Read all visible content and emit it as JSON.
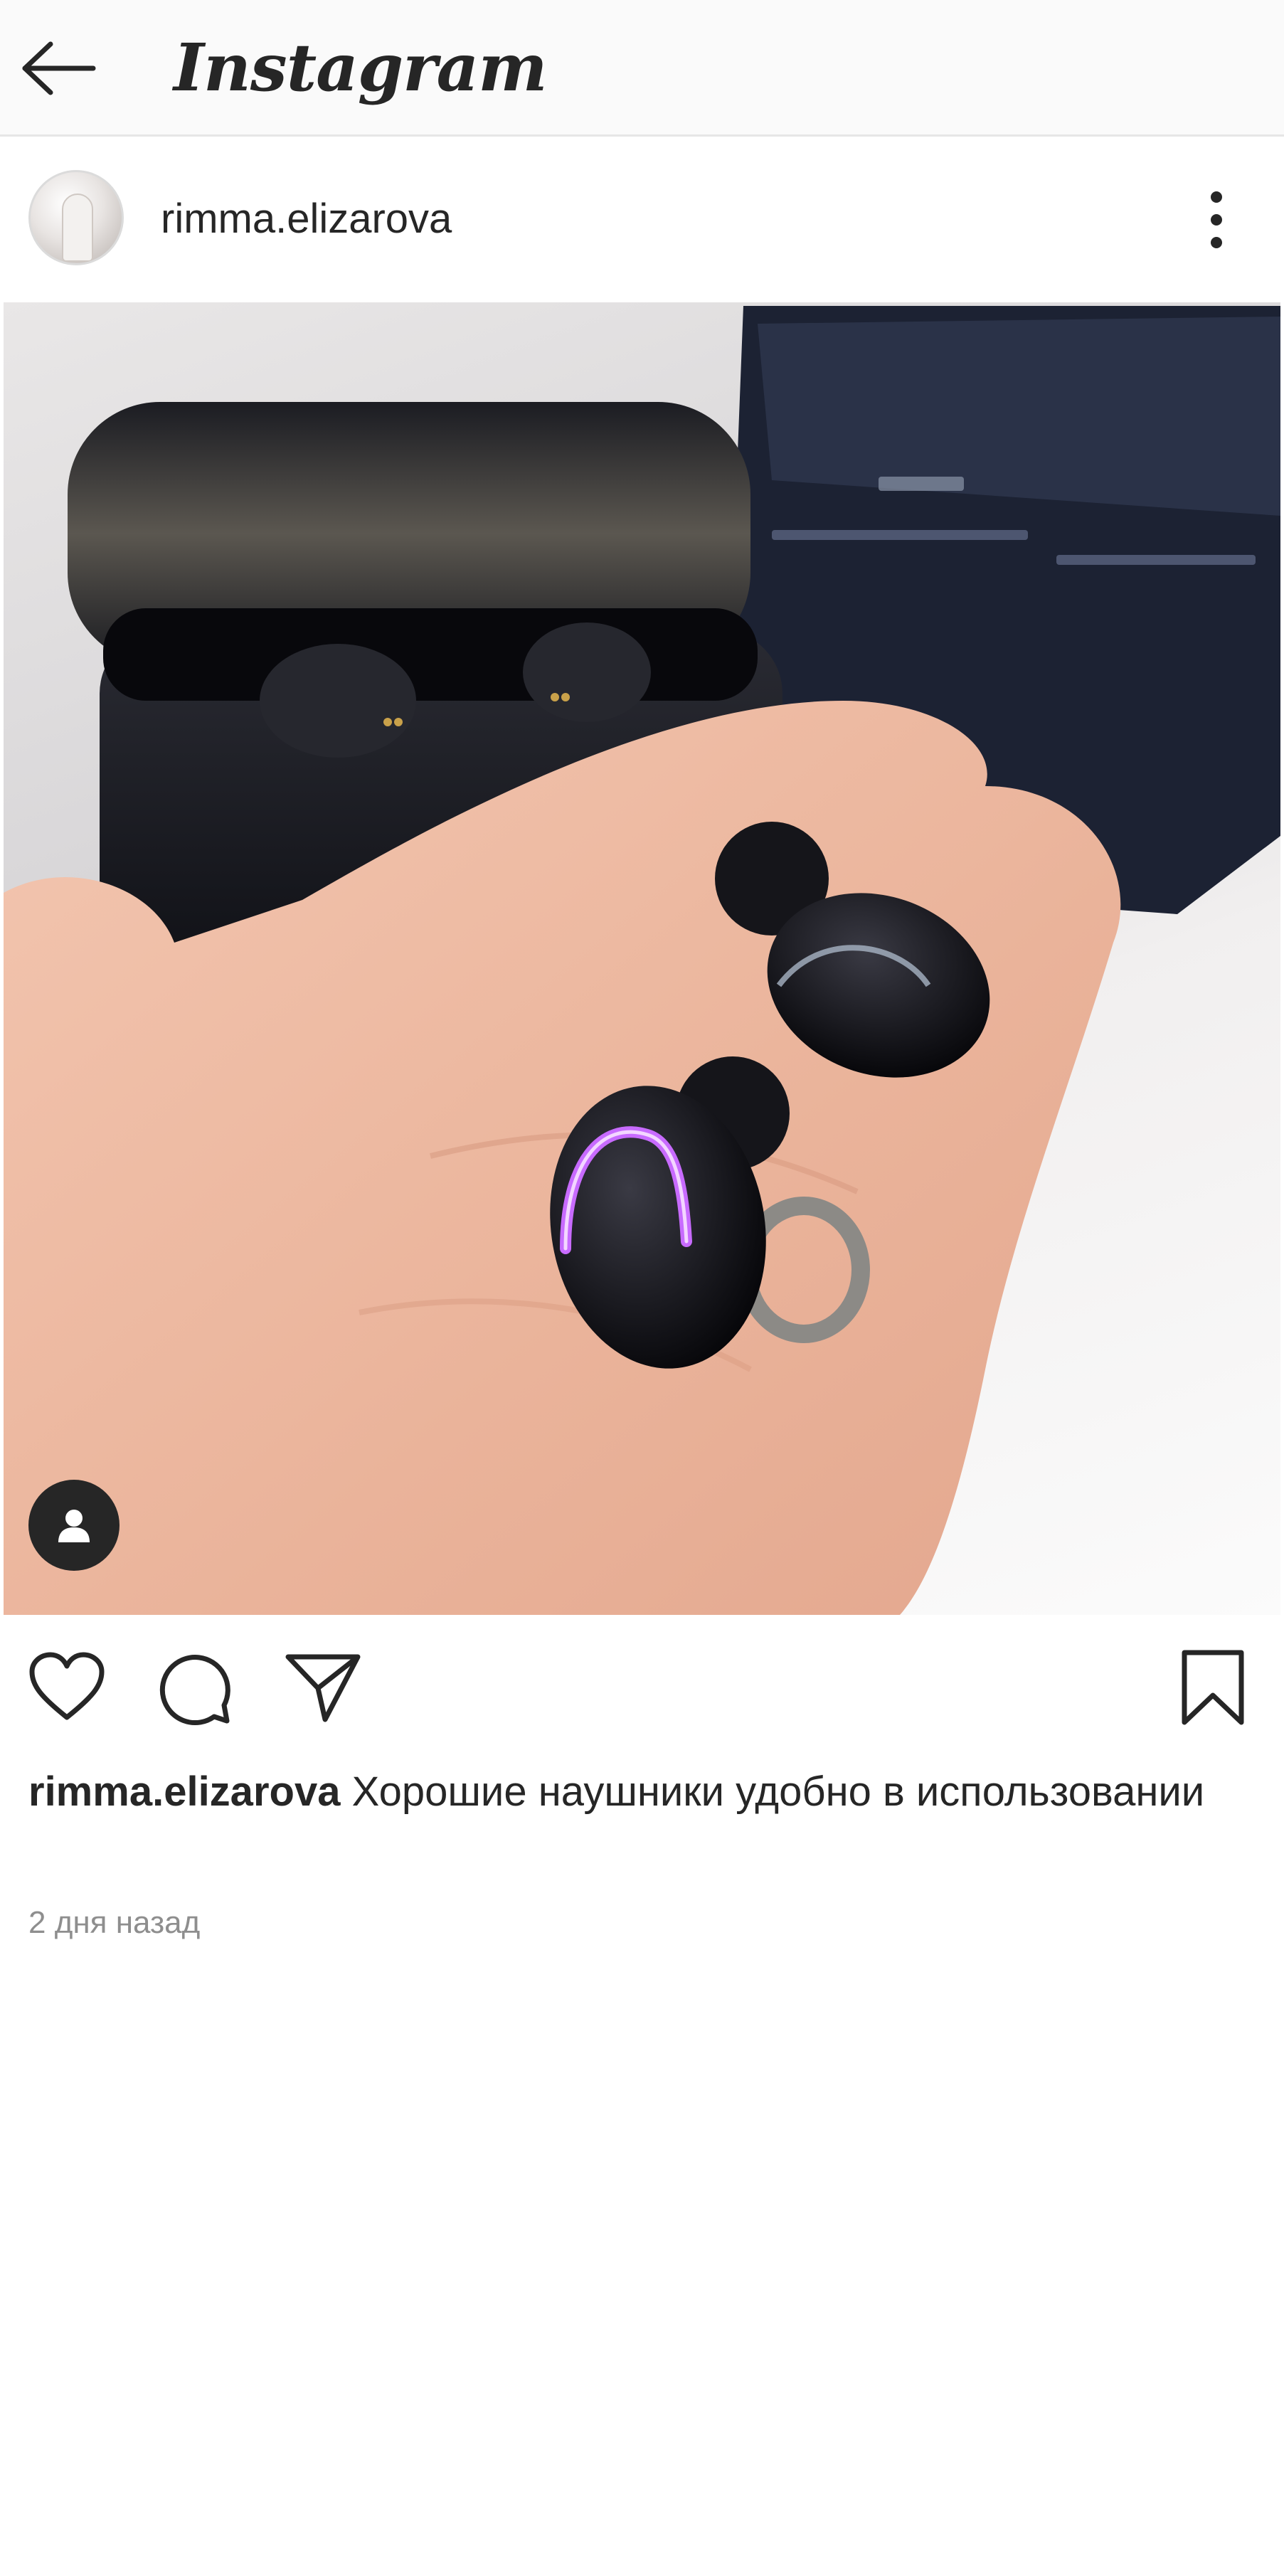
{
  "app": {
    "title": "Instagram"
  },
  "header": {
    "back_icon": "arrow-left-icon"
  },
  "post": {
    "username": "rimma.elizarova",
    "more_icon": "more-vertical-icon",
    "photo": {
      "icon_tag": "user-tag-icon"
    },
    "actions": {
      "like_icon": "heart-icon",
      "comment_icon": "comment-icon",
      "share_icon": "send-icon",
      "save_icon": "bookmark-icon"
    },
    "caption": {
      "username": "rimma.elizarova",
      "text": "Хорошие наушники удобно в использовании"
    },
    "timestamp": "2 дня назад"
  },
  "colors": {
    "topbar_bg": "#fafafa",
    "text": "#262626",
    "muted": "#8e8e8e",
    "earbud_led": "#c86bff"
  }
}
